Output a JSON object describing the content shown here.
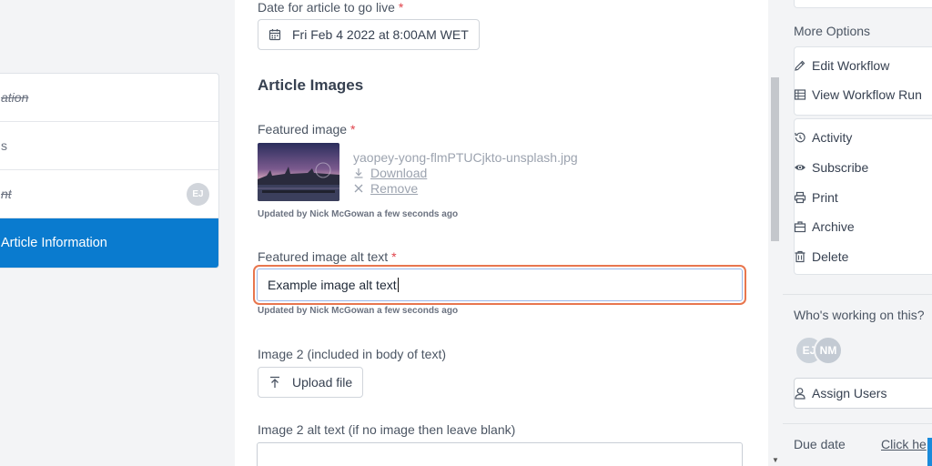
{
  "steps": [
    {
      "label": "ation",
      "state": "done"
    },
    {
      "label": "s",
      "state": "plain"
    },
    {
      "label": "nt",
      "state": "done",
      "avatar": "EJ"
    },
    {
      "label": "Article Information",
      "state": "active"
    }
  ],
  "form": {
    "date_label": "Date for article to go live",
    "required_mark": "*",
    "date_value": "Fri Feb 4 2022 at 8:00AM WET",
    "section_title": "Article Images",
    "featured_label": "Featured image",
    "file_name": "yaopey-yong-flmPTUCjkto-unsplash.jpg",
    "download_label": "Download",
    "remove_label": "Remove",
    "featured_meta": "Updated by Nick McGowan a few seconds ago",
    "alt_label": "Featured image alt text",
    "alt_value": "Example image alt text",
    "alt_meta": "Updated by Nick McGowan a few seconds ago",
    "image2_label": "Image 2 (included in body of text)",
    "upload_label": "Upload file",
    "image2_alt_label": "Image 2 alt text (if no image then leave blank)",
    "image2_alt_value": ""
  },
  "sidebar": {
    "more_options_title": "More Options",
    "options_group1": [
      {
        "label": "Edit Workflow",
        "icon": "pencil-icon"
      },
      {
        "label": "View Workflow Run",
        "icon": "table-icon"
      }
    ],
    "options_group2": [
      {
        "label": "Activity",
        "icon": "history-icon"
      },
      {
        "label": "Subscribe",
        "icon": "eye-icon"
      },
      {
        "label": "Print",
        "icon": "printer-icon"
      },
      {
        "label": "Archive",
        "icon": "archive-icon"
      },
      {
        "label": "Delete",
        "icon": "trash-icon"
      }
    ],
    "working_title": "Who's working on this?",
    "avatars": [
      "EJ",
      "NM"
    ],
    "assign_label": "Assign Users",
    "due_label": "Due date",
    "due_link": "Click he"
  },
  "colors": {
    "active_step": "#0a7bcf",
    "focus_ring": "#e8764e",
    "required": "#e0434b"
  }
}
